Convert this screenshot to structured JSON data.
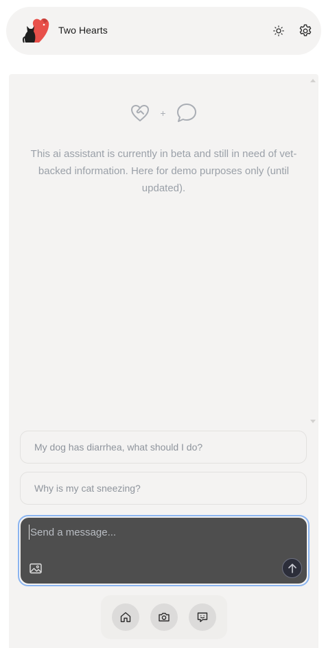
{
  "header": {
    "app_title": "Two Hearts",
    "logo_icon": "two-hearts-pets-logo",
    "theme_icon": "sun-icon",
    "settings_icon": "gear-icon"
  },
  "main": {
    "hero_icons": [
      "heart-handshake-icon",
      "plus",
      "speech-bubble-icon"
    ],
    "hero_plus": "+",
    "disclaimer": "This ai assistant is currently in beta and still in need of vet-backed information. Here for demo purposes only (until updated)."
  },
  "suggestions": [
    {
      "label": "My dog has diarrhea, what should I do?"
    },
    {
      "label": "Why is my cat sneezing?"
    }
  ],
  "composer": {
    "value": "",
    "placeholder": "Send a message...",
    "image_icon": "image-icon",
    "send_icon": "arrow-up-icon"
  },
  "bottom_nav": {
    "items": [
      {
        "icon": "home-icon"
      },
      {
        "icon": "camera-icon"
      },
      {
        "icon": "chat-icon"
      }
    ]
  },
  "colors": {
    "logo_red": "#e8504a",
    "logo_dark": "#1e1e1e",
    "focus_ring": "#8ab4f0",
    "composer_bg": "#4e4e4e",
    "panel_bg": "#f4f3f2"
  }
}
